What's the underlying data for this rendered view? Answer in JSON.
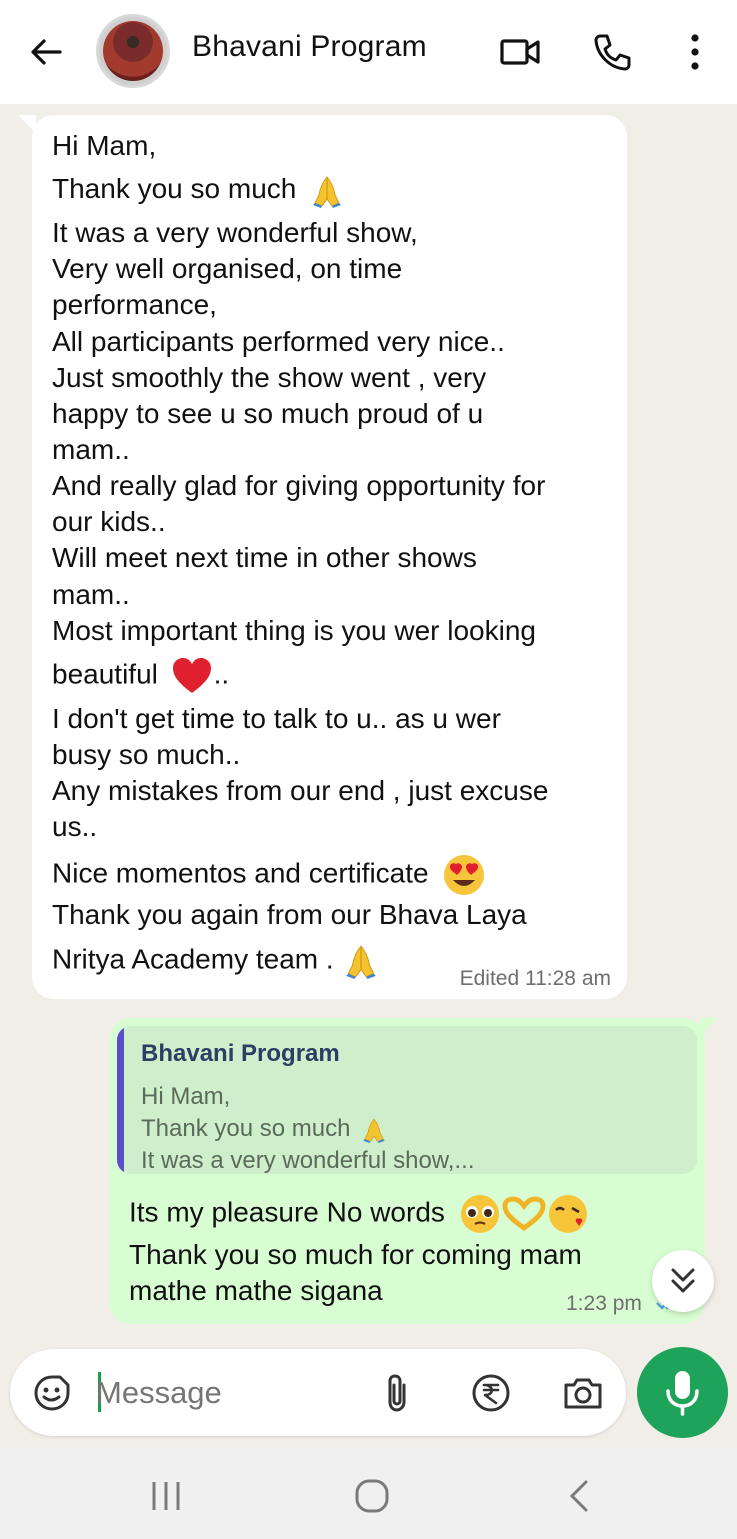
{
  "header": {
    "title": "Bhavani Program",
    "icons": [
      "back-arrow-icon",
      "avatar",
      "video-call-icon",
      "phone-icon",
      "more-vert-icon"
    ]
  },
  "incoming": {
    "lines": [
      "Hi Mam,",
      "Thank you so much",
      "It was a very wonderful show,",
      "Very well organised, on time",
      "performance,",
      "All participants performed very nice..",
      "Just smoothly the show went , very",
      "happy to see u so much proud of u",
      "mam..",
      "And really glad for giving opportunity for",
      "our kids..",
      "Will meet next time in other shows",
      "mam..",
      "Most important thing is you wer looking",
      "beautiful",
      "..",
      "I don't get time to talk to u.. as u wer",
      "busy so much..",
      "Any mistakes from our end , just excuse",
      "us..",
      "Nice momentos and certificate",
      "Thank you again from our Bhava Laya",
      "Nritya Academy team ."
    ],
    "emojis": [
      "folded-hands",
      "red-heart",
      "heart-eyes",
      "folded-hands"
    ],
    "time": "Edited 11:28 am"
  },
  "outgoing": {
    "quote": {
      "name": "Bhavani Program",
      "line1": "Hi Mam,",
      "line2": "Thank you so much",
      "line3": "It was a very wonderful show,..."
    },
    "lines": [
      "Its my pleasure No words",
      "Thank you so much for coming mam",
      "mathe mathe sigana"
    ],
    "emojis": [
      "pleading-face",
      "heart-hands",
      "face-blowing-kiss"
    ],
    "time": "1:23 pm",
    "status": "read"
  },
  "composer": {
    "placeholder": "Message",
    "icons": [
      "sticker-icon",
      "attach-icon",
      "rupee-payment-icon",
      "camera-icon",
      "mic-icon"
    ]
  },
  "colors": {
    "incoming_bubble": "#ffffff",
    "outgoing_bubble": "#d9fdd3",
    "quote_bar": "#5b4fc9",
    "mic_button": "#1ea35a",
    "chat_background": "#f1ede7",
    "read_ticks": "#4aa3e6"
  }
}
